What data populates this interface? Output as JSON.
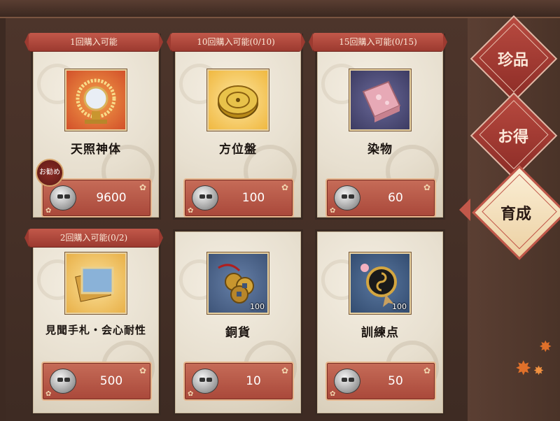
{
  "shop": {
    "items": [
      {
        "limit": "1回購入可能",
        "name": "天照神体",
        "price": "9600",
        "recommend": "お勧め",
        "qty": ""
      },
      {
        "limit": "10回購入可能(0/10)",
        "name": "方位盤",
        "price": "100",
        "qty": ""
      },
      {
        "limit": "15回購入可能(0/15)",
        "name": "染物",
        "price": "60",
        "qty": ""
      },
      {
        "limit": "2回購入可能(0/2)",
        "name": "見聞手札・会心耐性",
        "price": "500",
        "qty": ""
      },
      {
        "limit": "",
        "name": "銅貨",
        "price": "10",
        "qty": "100"
      },
      {
        "limit": "",
        "name": "訓練点",
        "price": "50",
        "qty": "100"
      }
    ]
  },
  "tabs": [
    {
      "label": "珍品",
      "active": false
    },
    {
      "label": "お得",
      "active": false
    },
    {
      "label": "育成",
      "active": true
    }
  ],
  "colors": {
    "accent": "#c2584a",
    "tab_active": "#f6e3c3",
    "tab_inactive": "#9c3a30"
  },
  "icons": {
    "currency": "stone-coin-icon"
  }
}
